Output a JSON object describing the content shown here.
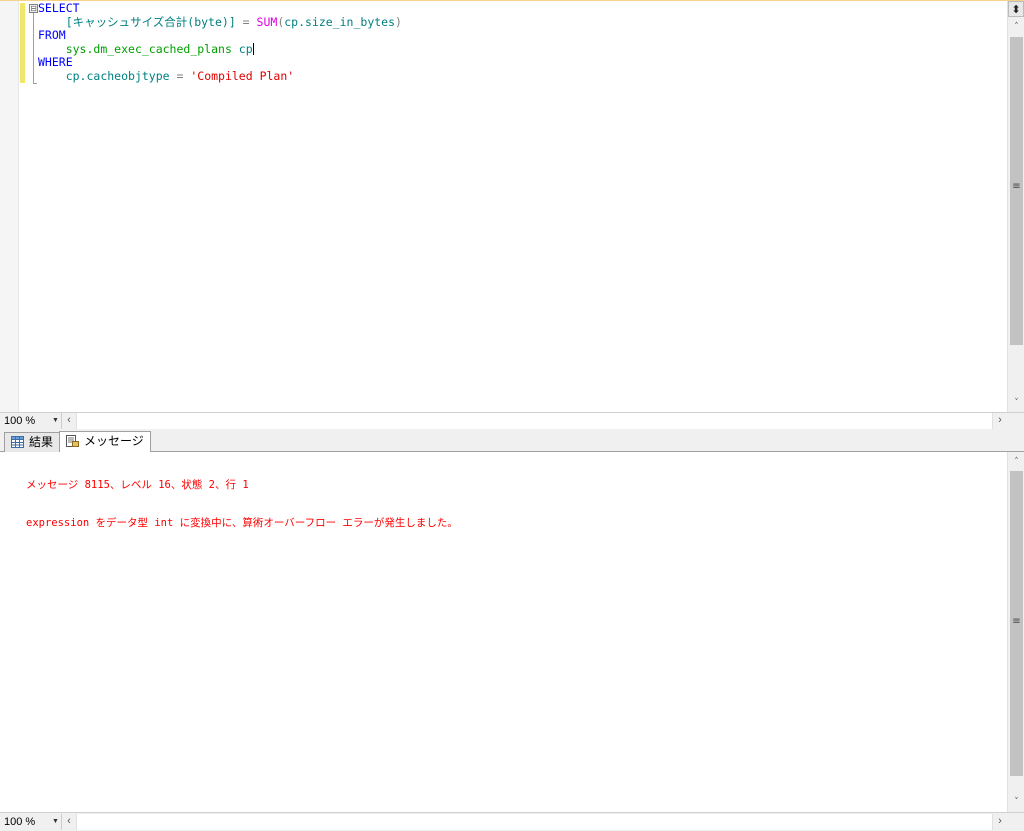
{
  "editor": {
    "fold_symbol": "⊟",
    "lines": [
      {
        "indent": "",
        "tokens": [
          {
            "text": "SELECT",
            "kind": "kw"
          }
        ]
      },
      {
        "indent": "    ",
        "tokens": [
          {
            "text": "[キャッシュサイズ合計(byte)]",
            "kind": "id"
          },
          {
            "text": " = ",
            "kind": "gray"
          },
          {
            "text": "SUM",
            "kind": "fn"
          },
          {
            "text": "(",
            "kind": "gray"
          },
          {
            "text": "cp.size_in_bytes",
            "kind": "id"
          },
          {
            "text": ")",
            "kind": "gray"
          }
        ]
      },
      {
        "indent": "",
        "tokens": [
          {
            "text": "FROM",
            "kind": "kw"
          }
        ]
      },
      {
        "indent": "    ",
        "tokens": [
          {
            "text": "sys.dm_exec_cached_plans",
            "kind": "sys"
          },
          {
            "text": " cp",
            "kind": "id"
          }
        ],
        "caret": true
      },
      {
        "indent": "",
        "tokens": [
          {
            "text": "WHERE",
            "kind": "kw"
          }
        ]
      },
      {
        "indent": "    ",
        "tokens": [
          {
            "text": "cp.cacheobjtype",
            "kind": "id"
          },
          {
            "text": " = ",
            "kind": "gray"
          },
          {
            "text": "'Compiled Plan'",
            "kind": "str"
          }
        ]
      }
    ]
  },
  "editor_zoom": "100 %",
  "results_zoom": "100 %",
  "tabs": [
    {
      "label": "結果",
      "icon": "grid-icon",
      "active": false
    },
    {
      "label": "メッセージ",
      "icon": "message-document-icon",
      "active": true
    }
  ],
  "messages": [
    "メッセージ 8115、レベル 16、状態 2、行 1",
    "expression をデータ型 int に変換中に、算術オーバーフロー エラーが発生しました。"
  ],
  "colors": {
    "keyword": "#0000ff",
    "identifier": "#008080",
    "system_object": "#00a000",
    "function": "#e000e0",
    "string": "#e00000",
    "error_text": "#ff0000",
    "change_bar": "#f0e66a"
  }
}
